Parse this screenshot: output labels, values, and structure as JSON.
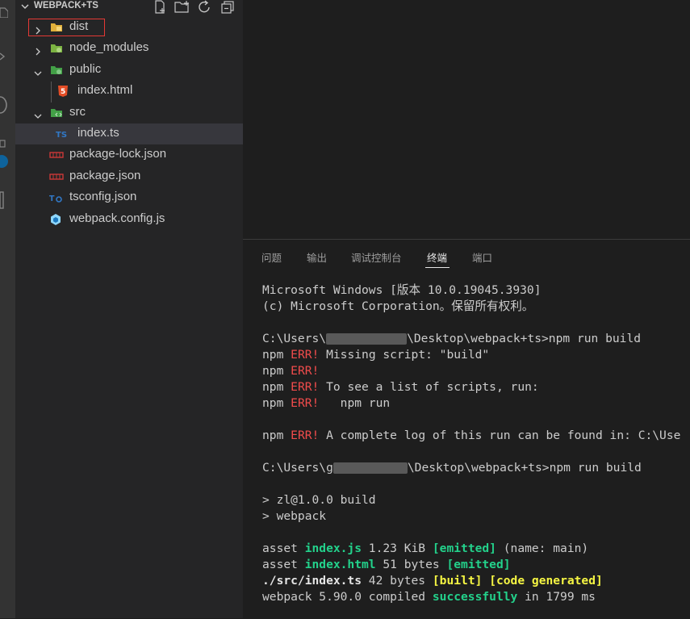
{
  "explorer": {
    "title": "WEBPACK+TS",
    "actions": [
      "new-file-icon",
      "new-folder-icon",
      "refresh-icon",
      "collapse-all-icon"
    ]
  },
  "tree": [
    {
      "label": "dist"
    },
    {
      "label": "node_modules"
    },
    {
      "label": "public"
    },
    {
      "label": "index.html"
    },
    {
      "label": "src"
    },
    {
      "label": "index.ts"
    },
    {
      "label": "package-lock.json"
    },
    {
      "label": "package.json"
    },
    {
      "label": "tsconfig.json"
    },
    {
      "label": "webpack.config.js"
    }
  ],
  "panel": {
    "tabs": [
      "问题",
      "输出",
      "调试控制台",
      "终端",
      "端口"
    ],
    "active_tab": "终端"
  },
  "terminal": {
    "l1": "Microsoft Windows [版本 10.0.19045.3930]",
    "l2": "(c) Microsoft Corporation。保留所有权利。",
    "cmd1_a": "C:\\Users\\",
    "cmd1_b": "\\Desktop\\webpack+ts>npm run build",
    "npm": "npm ",
    "err": "ERR!",
    "e1": " Missing script: \"build\"",
    "e3": " To see a list of scripts, run:",
    "e4": "   npm run",
    "e5": " A complete log of this run can be found in: C:\\Use",
    "cmd2_a": "C:\\Users\\g",
    "cmd2_b": "\\Desktop\\webpack+ts>npm run build",
    "b1": "> zl@1.0.0 build",
    "b2": "> webpack",
    "asset": "asset ",
    "f1": "index.js",
    "s1": " 1.23 KiB ",
    "emitted": "[emitted]",
    "n1": " (name: main)",
    "f2": "index.html",
    "s2": " 51 bytes ",
    "src": "./src/index.ts",
    "s3": " 42 bytes ",
    "built": "[built]",
    "codegen": "[code generated]",
    "w1": "webpack 5.90.0 compiled ",
    "ok": "successfully",
    "w2": " in 1799 ms"
  }
}
